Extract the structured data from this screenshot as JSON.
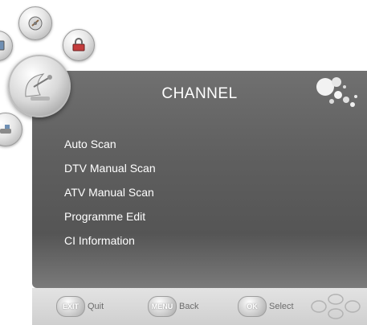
{
  "menu": {
    "title": "CHANNEL",
    "items": [
      {
        "label": "Auto Scan"
      },
      {
        "label": "DTV Manual Scan"
      },
      {
        "label": "ATV Manual Scan"
      },
      {
        "label": "Programme Edit"
      },
      {
        "label": "CI Information"
      }
    ]
  },
  "categories": [
    {
      "icon": "picture-icon"
    },
    {
      "icon": "sound-icon"
    },
    {
      "icon": "satellite-dish-icon"
    },
    {
      "icon": "clock-icon"
    },
    {
      "icon": "lock-icon"
    },
    {
      "icon": "setup-icon"
    }
  ],
  "footer": {
    "exit_key": "EXIT",
    "exit_label": "Quit",
    "menu_key": "MENU",
    "menu_label": "Back",
    "ok_key": "OK",
    "ok_label": "Select"
  }
}
